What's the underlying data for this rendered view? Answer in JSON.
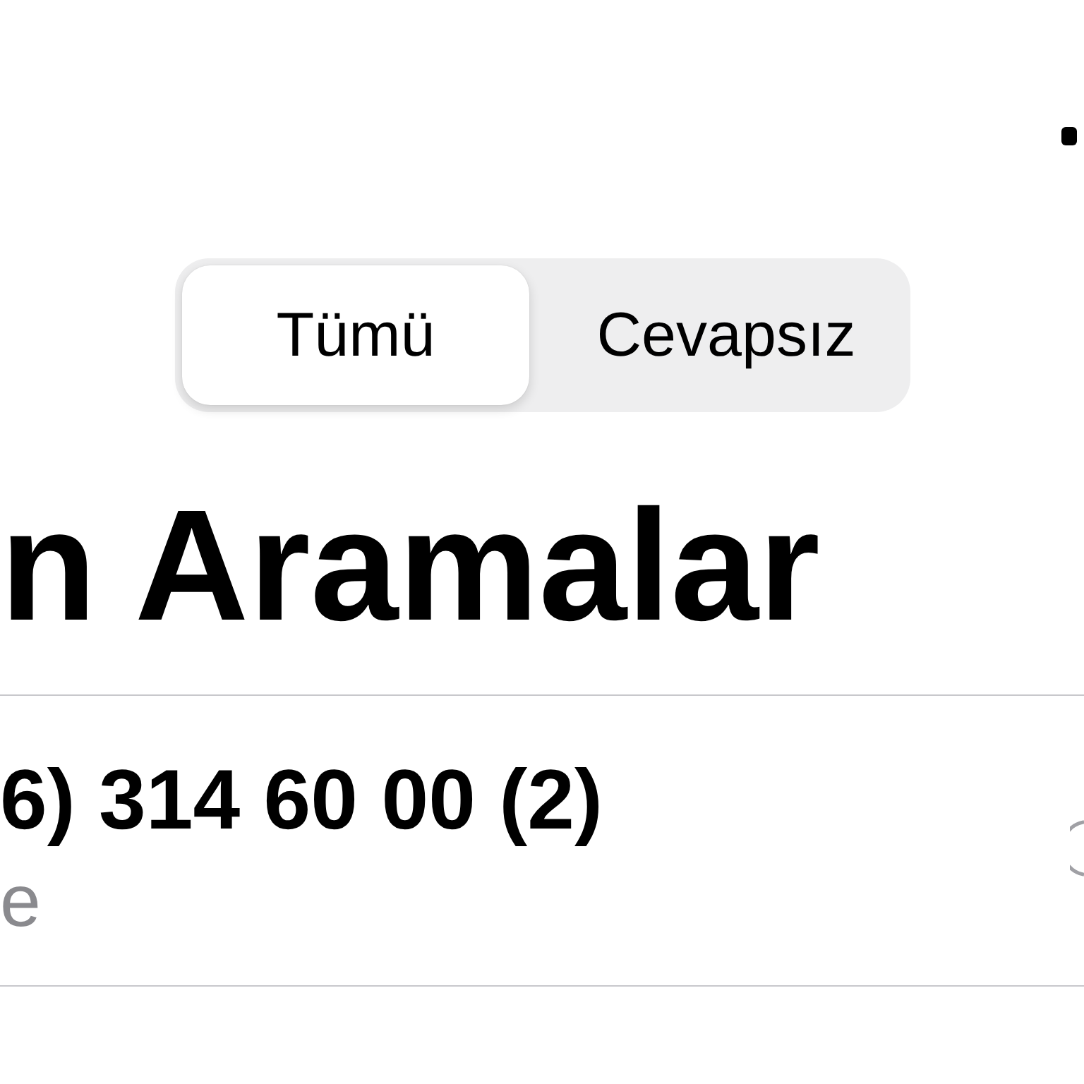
{
  "segmented_control": {
    "segments": [
      {
        "label": "Tümü",
        "selected": true
      },
      {
        "label": "Cevapsız",
        "selected": false
      }
    ]
  },
  "title": "n Aramalar",
  "calls": [
    {
      "name": "6) 314 60 00 (2)",
      "detail": "e"
    }
  ]
}
